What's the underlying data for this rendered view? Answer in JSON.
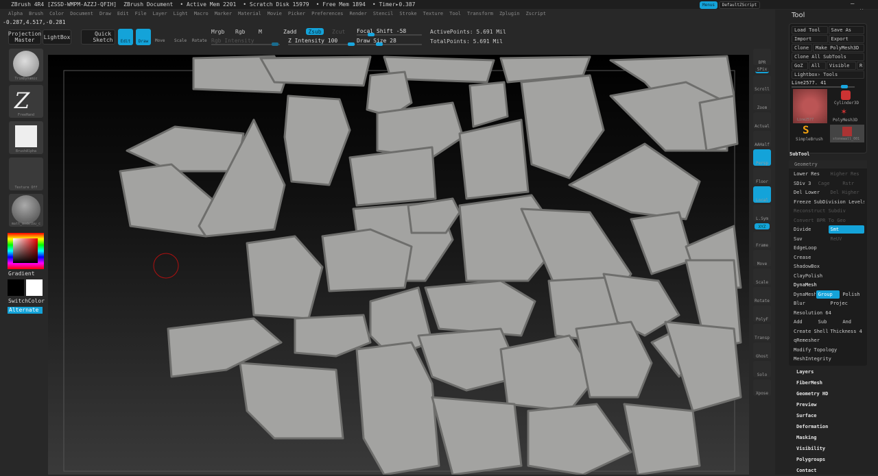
{
  "title_bar": {
    "app": "ZBrush 4R4 [ZSSD-WMPM-AZZJ-QFIH]",
    "document": "ZBrush Document",
    "active_mem": "• Active Mem 2201",
    "scratch": "• Scratch Disk 15979",
    "free_mem": "• Free Mem 1894",
    "timer": "• Timer▸0.387",
    "menus_btn": "Menus",
    "script_btn": "DefaultZScript"
  },
  "menu": [
    "Alpha",
    "Brush",
    "Color",
    "Document",
    "Draw",
    "Edit",
    "File",
    "Layer",
    "Light",
    "Macro",
    "Marker",
    "Material",
    "Movie",
    "Picker",
    "Preferences",
    "Render",
    "Stencil",
    "Stroke",
    "Texture",
    "Tool",
    "Transform",
    "Zplugin",
    "Zscript"
  ],
  "coords": "-0.287,4.517,-0.281",
  "toolbar": {
    "projection_master": "Projection Master",
    "lightbox": "LightBox",
    "quick_sketch": "Quick Sketch",
    "edit": "Edit",
    "draw": "Draw",
    "move": "Move",
    "scale": "Scale",
    "rotate": "Rotate",
    "mrgb": "Mrgb",
    "rgb": "Rgb",
    "m": "M",
    "rgb_intensity": "Rgb Intensity",
    "zadd": "Zadd",
    "zsub": "Zsub",
    "zcut": "Zcut",
    "z_intensity": "Z Intensity 100",
    "focal_shift": "Focal Shift -58",
    "draw_size": "Draw Size 28",
    "active_points": "ActivePoints: 5.691 Mil",
    "total_points": "TotalPoints: 5.691 Mil",
    "z_intensity_value": 100,
    "focal_shift_value": -58,
    "draw_size_value": 28
  },
  "left_shelf": {
    "brush": "TrimDynamic",
    "stroke": "FreeHand",
    "alpha": "BrushAlpha",
    "texture": "Texture Off",
    "material": "matt_modelbu_c",
    "gradient": "Gradient",
    "switch_color": "SwitchColor",
    "alternate": "Alternate",
    "main_color": "#000000",
    "secondary_color": "#ffffff"
  },
  "right_shelf": [
    "BPR",
    "SPix",
    "Scroll",
    "Zoom",
    "Actual",
    "AAHalf",
    "Persp",
    "Floor",
    "Local",
    "L.Sym",
    "XYZ",
    "Frame",
    "Move",
    "Scale",
    "Rotate",
    "PolyF",
    "Transp",
    "Ghost",
    "Solo",
    "Xpose"
  ],
  "tool_panel": {
    "title": "Tool",
    "load_tool": "Load Tool",
    "save_as": "Save As",
    "import": "Import",
    "export": "Export",
    "clone": "Clone",
    "make_polymesh": "Make PolyMesh3D",
    "clone_all": "Clone All SubTools",
    "goz": "GoZ",
    "all": "All",
    "visible": "Visible",
    "r": "R",
    "lightbox_tools": "Lightbox› Tools",
    "current_tool": "Line2577. 41",
    "tools": [
      "Line2577",
      "Cylinder3D",
      "PolyMesh3D",
      "SimpleBrush",
      "stonewall_001"
    ],
    "subtool": "SubTool",
    "geometry": "Geometry",
    "lower_res": "Lower Res",
    "higher_res": "Higher Res",
    "sdiv": "SDiv 3",
    "cage": "Cage",
    "rstr": "Rstr",
    "del_lower": "Del Lower",
    "del_higher": "Del Higher",
    "freeze": "Freeze SubDivision Levels",
    "reconstruct": "Reconstruct Subdiv",
    "convert_bpr": "Convert BPR To Geo",
    "divide": "Divide",
    "smt": "Smt",
    "suv": "Suv",
    "reuv": "ReUV",
    "edgeloop": "EdgeLoop",
    "crease": "Crease",
    "shadowbox": "ShadowBox",
    "claypolish": "ClayPolish",
    "dynamesh_header": "DynaMesh",
    "dynamesh": "DynaMesh",
    "group": "Group",
    "polish": "Polish",
    "blur": "Blur",
    "project": "Projec",
    "resolution": "Resolution 64",
    "add": "Add",
    "sub": "Sub",
    "and": "And",
    "create_shell": "Create Shell",
    "thickness": "Thickness 4",
    "qremesher": "qRemesher",
    "modify_topology": "Modify Topology",
    "meshintegrity": "MeshIntegrity",
    "sections": [
      "Layers",
      "FiberMesh",
      "Geometry HD",
      "Preview",
      "Surface",
      "Deformation",
      "Masking",
      "Visibility",
      "Polygroups",
      "Contact"
    ]
  }
}
